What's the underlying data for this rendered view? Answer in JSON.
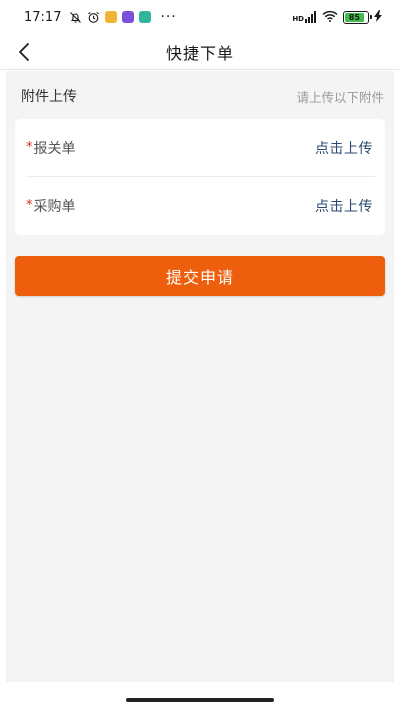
{
  "status_bar": {
    "time": "17:17",
    "more": "···",
    "network_badge": "HD",
    "battery_level": "85"
  },
  "nav": {
    "title": "快捷下单"
  },
  "attachments": {
    "title": "附件上传",
    "hint": "请上传以下附件",
    "items": [
      {
        "required_mark": "*",
        "label": "报关单",
        "action": "点击上传"
      },
      {
        "required_mark": "*",
        "label": "采购单",
        "action": "点击上传"
      }
    ]
  },
  "submit": {
    "label": "提交申请"
  },
  "colors": {
    "accent": "#ee5f0d",
    "link": "#2b4a73",
    "required": "#d9281c",
    "background": "#f4f4f4"
  }
}
